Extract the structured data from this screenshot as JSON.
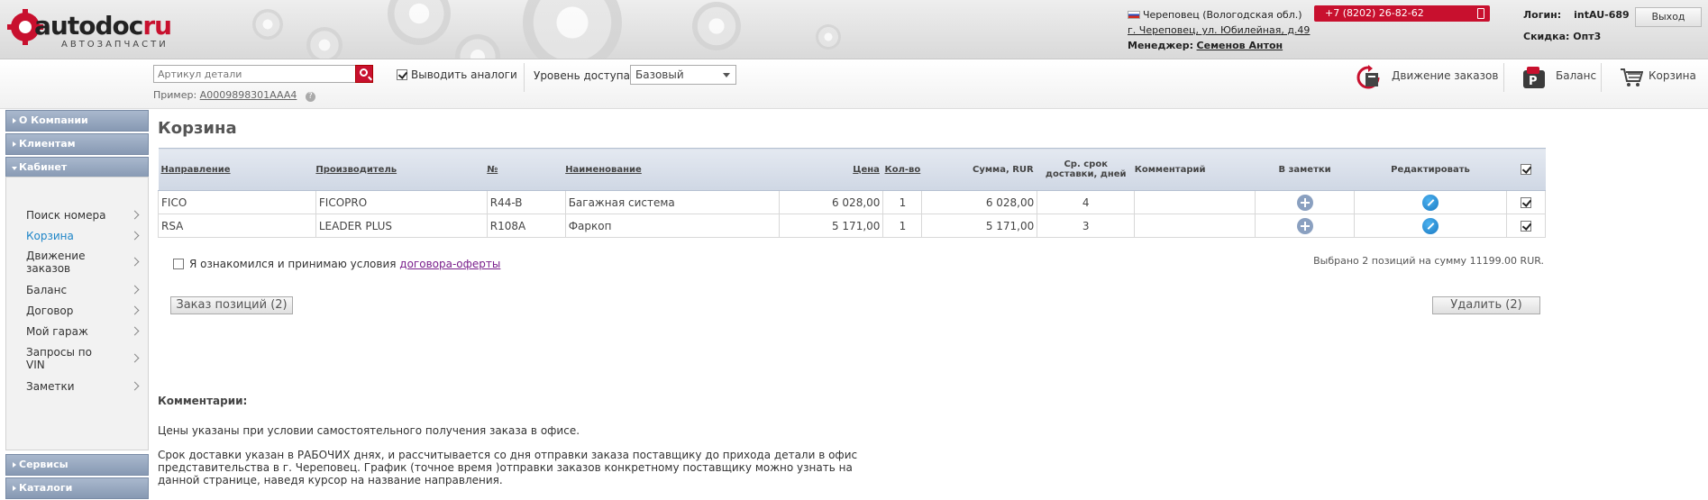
{
  "header": {
    "logo_text": "autodoc",
    "logo_suffix": "ru",
    "logo_subtitle": "АВТОЗАПЧАСТИ",
    "city": "Череповец (Вологодская обл.)",
    "address": "г. Череповец, ул. Юбилейная, д.49",
    "manager_label": "Менеджер:",
    "manager_name": "Семенов Антон",
    "phone": "+7 (8202) 26-82-62",
    "login_label": "Логин:",
    "login_value": "intAU-689",
    "discount_label": "Скидка:",
    "discount_value": "Опт3",
    "logout_label": "Выход"
  },
  "toolbar": {
    "search_placeholder": "Артикул детали",
    "example_label": "Пример:",
    "example_value": "A0009898301AAA4",
    "analogs_label": "Выводить аналоги",
    "analogs_checked": true,
    "access_label": "Уровень доступа",
    "access_value": "Базовый",
    "orders_link": "Движение заказов",
    "balance_link": "Баланс",
    "cart_link": "Корзина"
  },
  "sidebar": {
    "sections": [
      "О Компании",
      "Клиентам",
      "Кабинет",
      "Сервисы",
      "Каталоги"
    ],
    "cabinet_items": [
      "Поиск номера",
      "Корзина",
      "Движение заказов",
      "Баланс",
      "Договор",
      "Мой гараж",
      "Запросы по VIN",
      "Заметки"
    ],
    "active_item": "Корзина"
  },
  "main": {
    "title": "Корзина",
    "columns": [
      "Направление",
      "Производитель",
      "№",
      "Наименование",
      "Цена",
      "Кол-во",
      "Сумма, RUR",
      "Ср. срок доставки, дней",
      "Комментарий",
      "В заметки",
      "Редактировать"
    ],
    "rows": [
      {
        "direction": "FICO",
        "manufacturer": "FICOPRO",
        "number": "R44-B",
        "name": "Багажная система",
        "price": "6 028,00",
        "qty": "1",
        "sum": "6 028,00",
        "days": "4",
        "comment": "",
        "checked": true
      },
      {
        "direction": "RSA",
        "manufacturer": "LEADER PLUS",
        "number": "R108A",
        "name": "Фаркоп",
        "price": "5 171,00",
        "qty": "1",
        "sum": "5 171,00",
        "days": "3",
        "comment": "",
        "checked": true
      }
    ],
    "accept_text": "Я ознакомился и принимаю условия",
    "accept_link": "договора-оферты",
    "selected_summary": "Выбрано 2 позиций на сумму 11199.00 RUR.",
    "order_button": "Заказ позиций (2)",
    "delete_button": "Удалить (2)",
    "comments_title": "Комментарии:",
    "comment_1": "Цены указаны при условии самостоятельного получения заказа в офисе.",
    "comment_2": "Срок доставки указан в РАБОЧИХ днях, и рассчитывается со дня отправки заказа поставщику до прихода детали в офис представительства в г. Череповец. График (точное время )отправки заказов конкретному поставщику можно узнать на данной странице, наведя курсор на название направления."
  }
}
